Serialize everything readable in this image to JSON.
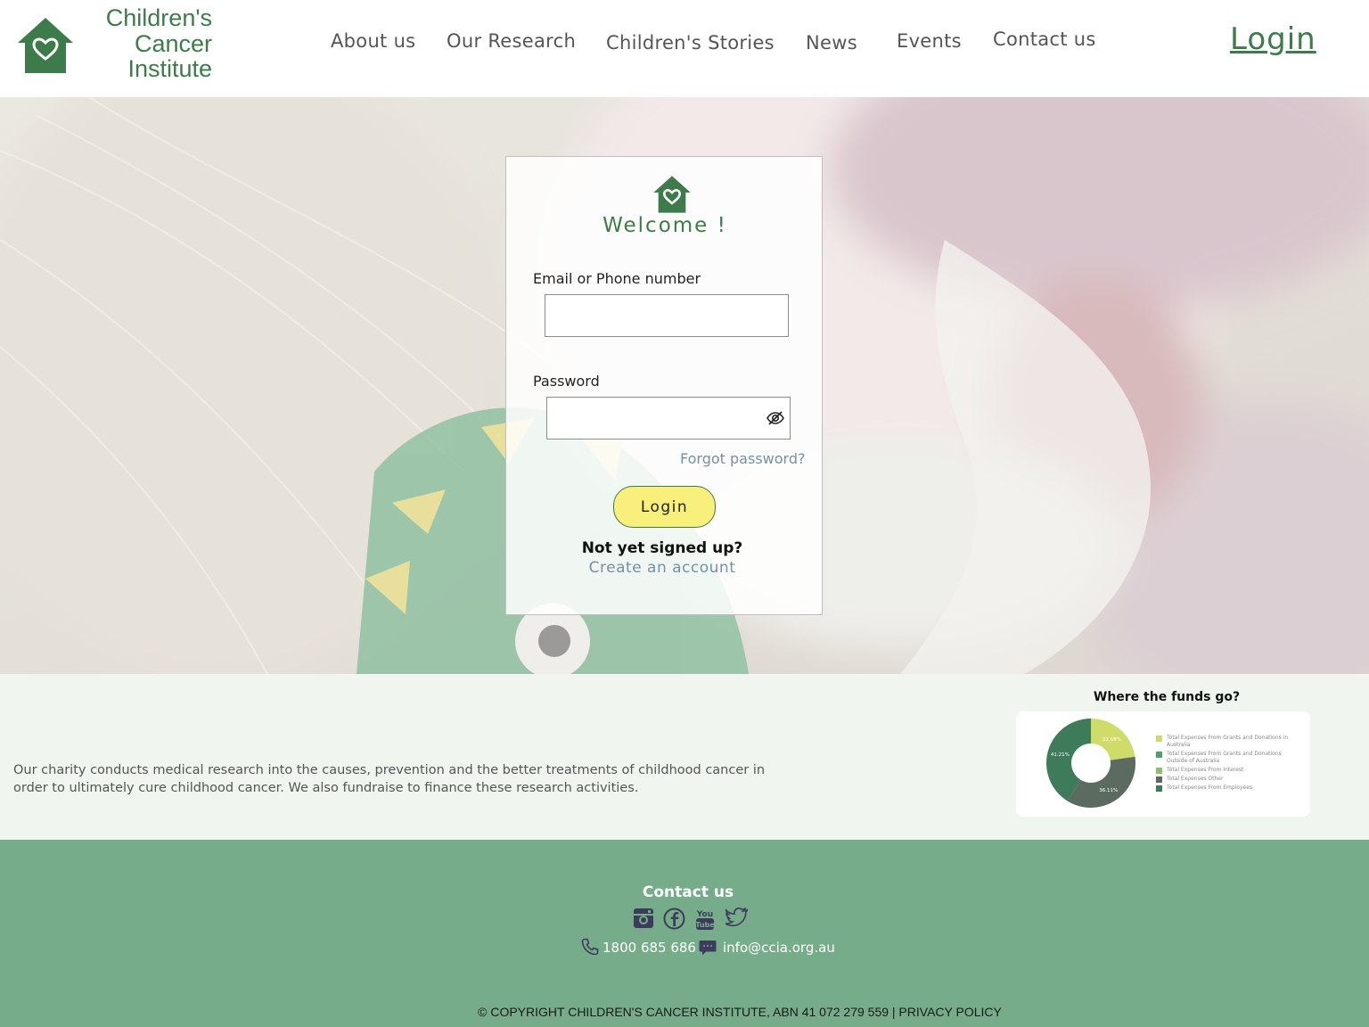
{
  "brand": {
    "name_lines": [
      "Children's",
      "Cancer",
      "Institute"
    ],
    "color": "#3e7b4a"
  },
  "nav": {
    "items": [
      "About us",
      "Our Research",
      "Children's Stories",
      "News",
      "Events",
      "Contact us"
    ],
    "login": "Login"
  },
  "login_card": {
    "welcome": "Welcome !",
    "email_label": "Email or Phone number",
    "email_value": "",
    "password_label": "Password",
    "password_value": "",
    "forgot": "Forgot password?",
    "login_button": "Login",
    "not_signed_up": "Not yet signed up?",
    "create_account": "Create an account",
    "button_color": "#f8f07a"
  },
  "info": {
    "description": "Our charity conducts medical research into the causes, prevention and the better treatments of childhood cancer in order to ultimately cure childhood cancer. We also fundraise to finance these research activities.",
    "funds_title": "Where the funds go?"
  },
  "chart_data": {
    "type": "pie",
    "title": "Where the funds go?",
    "donut": true,
    "categories": [
      "Total Expenses From Grants and Donations in Australia",
      "Total Expenses From Grants and Donations Outside of Australia",
      "Total Expenses From Interest",
      "Total Expenses Other",
      "Total Expenses From Employees"
    ],
    "values": [
      22.68,
      0,
      0,
      36.11,
      41.21
    ],
    "slice_labels": [
      "22.68%",
      "",
      "",
      "36.11%",
      "41.21%"
    ],
    "colors": [
      "#cfdc6a",
      "#4ea06a",
      "#8ac06c",
      "#5c6b5f",
      "#3e7b5a"
    ],
    "legend": "right"
  },
  "footer": {
    "title": "Contact us",
    "social_icons": [
      "instagram-icon",
      "facebook-icon",
      "youtube-icon",
      "twitter-icon"
    ],
    "phone": "1800 685 686",
    "email": "info@ccia.org.au",
    "copyright": "© COPYRIGHT CHILDREN'S CANCER INSTITUTE, ABN 41 072 279 559 | PRIVACY POLICY",
    "background": "#76ac89"
  }
}
